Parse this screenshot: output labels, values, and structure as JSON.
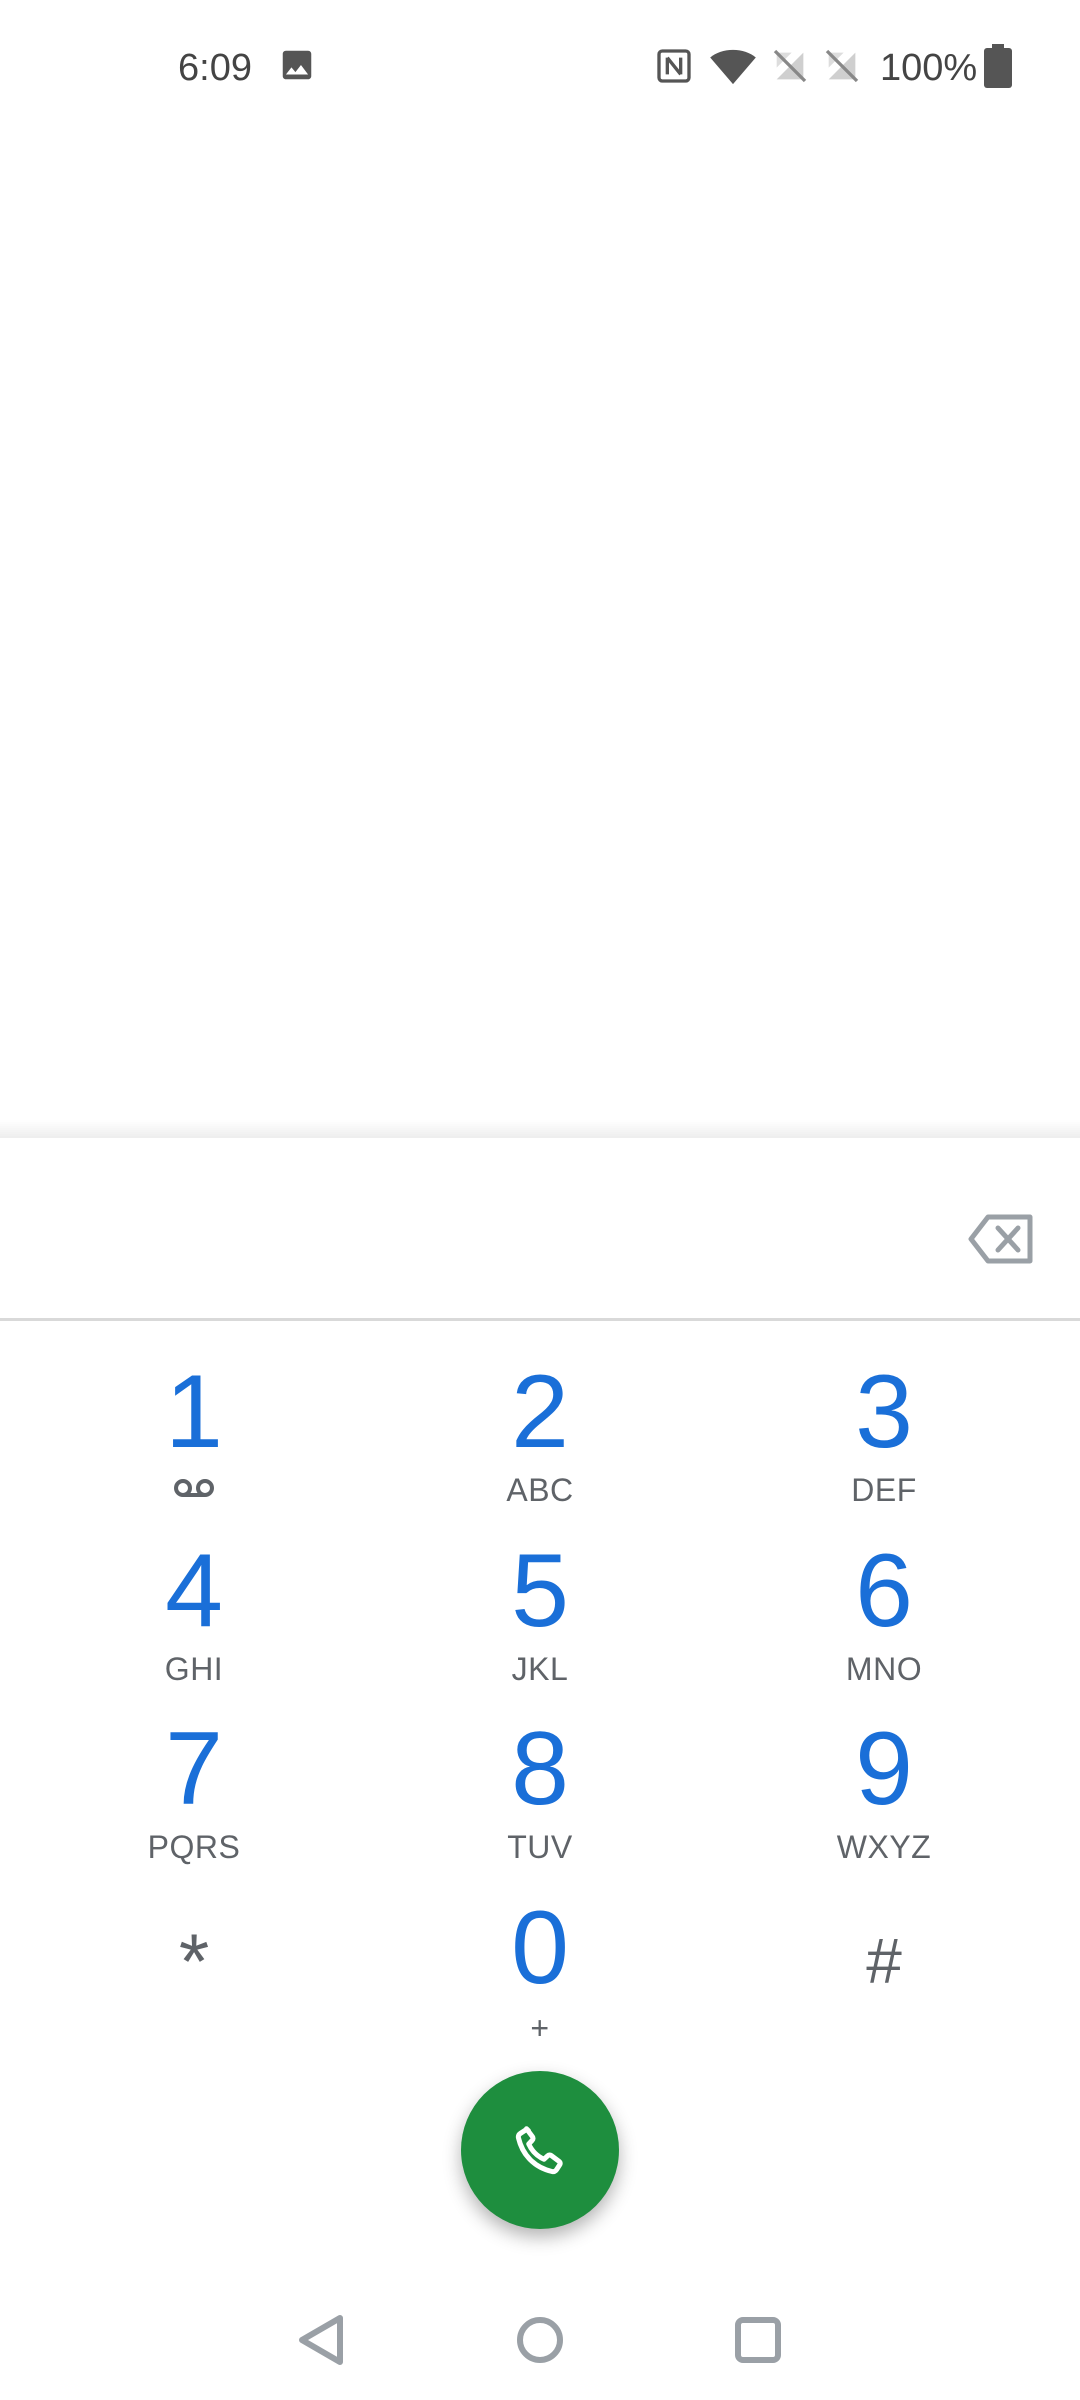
{
  "status_bar": {
    "time": "6:09",
    "battery_percent": "100%",
    "icons": [
      "image-icon",
      "nfc-icon",
      "wifi-icon",
      "no-sim-icon",
      "no-sim-icon",
      "battery-icon"
    ]
  },
  "dialpad": {
    "digits_value": "",
    "keys": [
      {
        "digit": "1",
        "letters": "",
        "extra_icon": "voicemail-icon"
      },
      {
        "digit": "2",
        "letters": "ABC"
      },
      {
        "digit": "3",
        "letters": "DEF"
      },
      {
        "digit": "4",
        "letters": "GHI"
      },
      {
        "digit": "5",
        "letters": "JKL"
      },
      {
        "digit": "6",
        "letters": "MNO"
      },
      {
        "digit": "7",
        "letters": "PQRS"
      },
      {
        "digit": "8",
        "letters": "TUV"
      },
      {
        "digit": "9",
        "letters": "WXYZ"
      },
      {
        "digit": "*",
        "letters": ""
      },
      {
        "digit": "0",
        "letters": "+"
      },
      {
        "digit": "#",
        "letters": ""
      }
    ]
  },
  "call_button": {
    "icon": "phone-icon"
  },
  "colors": {
    "digit_blue": "#1a6fd8",
    "call_green": "#1e8e3e",
    "secondary_text": "#5f6368"
  }
}
